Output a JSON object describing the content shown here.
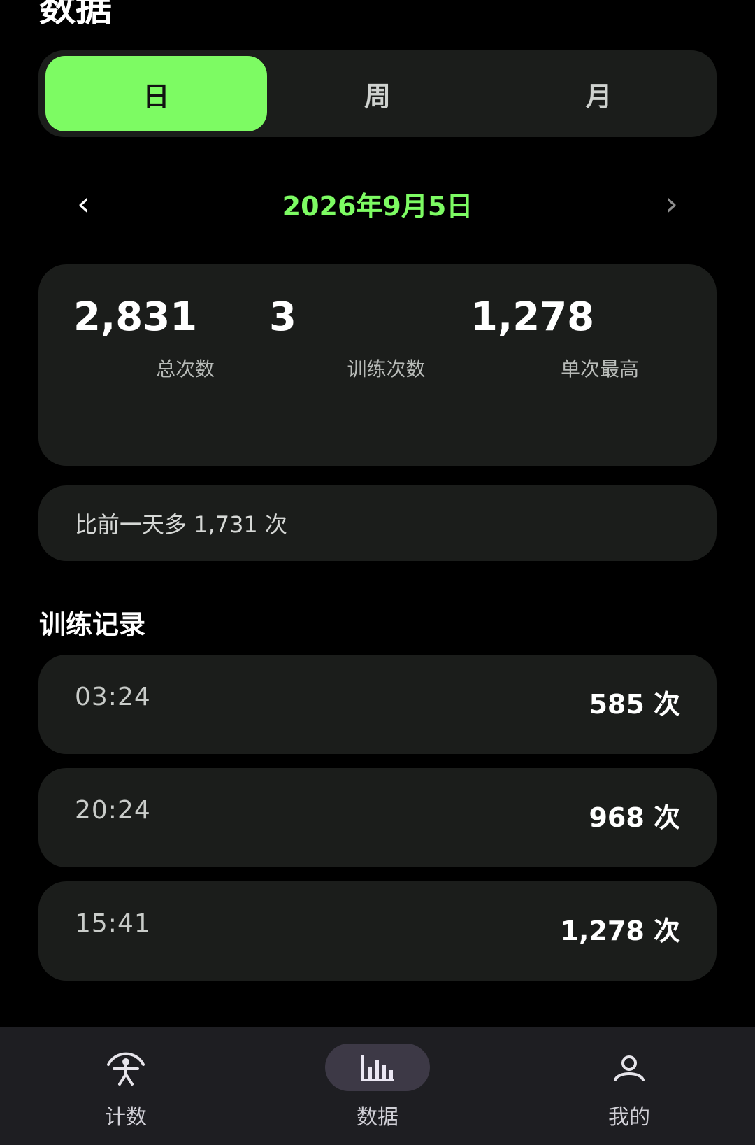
{
  "header": {
    "title": "数据"
  },
  "tabs": [
    {
      "label": "日",
      "active": true
    },
    {
      "label": "周",
      "active": false
    },
    {
      "label": "月",
      "active": false
    }
  ],
  "date_nav": {
    "prev": "‹",
    "date": "2026年9月5日",
    "next": "›"
  },
  "stats": [
    {
      "value": "2,831",
      "label": "总次数"
    },
    {
      "value": "3",
      "label": "训练次数"
    },
    {
      "value": "1,278",
      "label": "单次最高"
    }
  ],
  "compare": {
    "text": "比前一天多 1,731 次"
  },
  "records": {
    "title": "训练记录",
    "items": [
      {
        "time": "03:24",
        "count": "585 次"
      },
      {
        "time": "20:24",
        "count": "968 次"
      },
      {
        "time": "15:41",
        "count": "1,278 次"
      }
    ]
  },
  "bottom_nav": [
    {
      "label": "计数",
      "icon": "person-icon"
    },
    {
      "label": "数据",
      "icon": "bar-chart-icon",
      "active": true
    },
    {
      "label": "我的",
      "icon": "profile-icon"
    }
  ],
  "colors": {
    "accent": "#7dfb63",
    "card": "#1b1d1b",
    "nav": "#1e1e22",
    "nav_active": "#3d3946"
  }
}
